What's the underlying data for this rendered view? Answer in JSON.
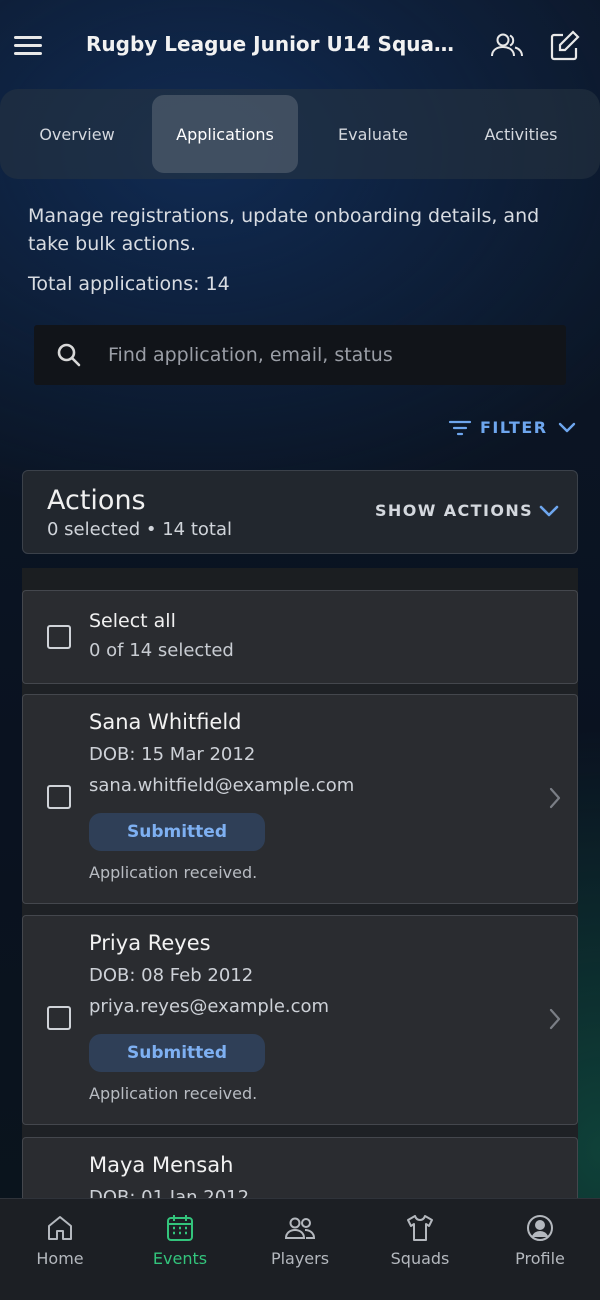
{
  "header": {
    "title": "Rugby League Junior U14 Squad ...",
    "icons": [
      "menu-icon",
      "people-icon",
      "edit-icon"
    ]
  },
  "tabs": [
    {
      "label": "Overview",
      "active": false
    },
    {
      "label": "Applications",
      "active": true
    },
    {
      "label": "Evaluate",
      "active": false
    },
    {
      "label": "Activities",
      "active": false
    }
  ],
  "intro": {
    "description": "Manage registrations, update onboarding details, and take bulk actions.",
    "total": "Total applications: 14"
  },
  "search": {
    "placeholder": "Find application, email, status"
  },
  "filter": {
    "label": "FILTER"
  },
  "actions": {
    "title": "Actions",
    "summary": "0 selected • 14 total",
    "show_label": "SHOW ACTIONS"
  },
  "select_all": {
    "label": "Select all",
    "summary": "0 of 14 selected"
  },
  "applications": [
    {
      "name": "Sana Whitfield",
      "dob": "DOB: 15 Mar 2012",
      "email": "sana.whitfield@example.com",
      "status": "Submitted",
      "note": "Application received."
    },
    {
      "name": "Priya Reyes",
      "dob": "DOB: 08 Feb 2012",
      "email": "priya.reyes@example.com",
      "status": "Submitted",
      "note": "Application received."
    },
    {
      "name": "Maya Mensah",
      "dob": "DOB: 01 Jan 2012",
      "email": "",
      "status": "",
      "note": ""
    }
  ],
  "bottom_nav": [
    {
      "label": "Home",
      "icon": "home-icon",
      "active": false
    },
    {
      "label": "Events",
      "icon": "calendar-icon",
      "active": true
    },
    {
      "label": "Players",
      "icon": "players-icon",
      "active": false
    },
    {
      "label": "Squads",
      "icon": "shirt-icon",
      "active": false
    },
    {
      "label": "Profile",
      "icon": "profile-icon",
      "active": false
    }
  ],
  "colors": {
    "accent": "#6ea6ee",
    "nav_active": "#33c47c",
    "badge_bg": "#2f3f57"
  }
}
